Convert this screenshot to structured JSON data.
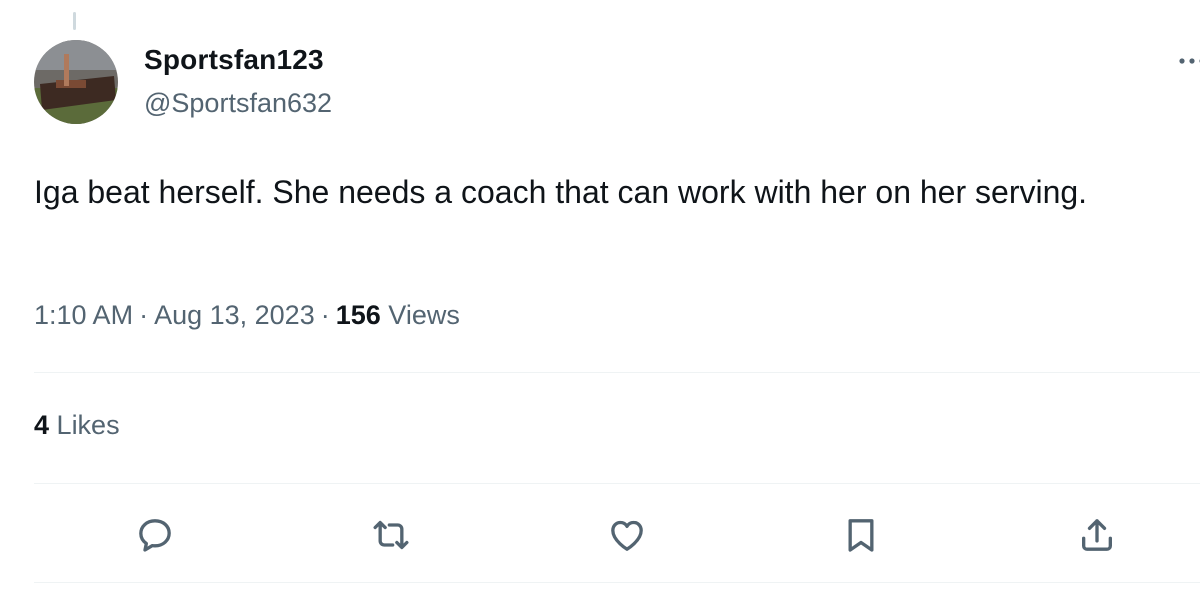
{
  "author": {
    "display_name": "Sportsfan123",
    "handle": "@Sportsfan632",
    "avatar_icon": "avatar-photo"
  },
  "tweet": {
    "text": "Iga beat herself. She needs a coach that can work with her on her serving."
  },
  "meta": {
    "time": "1:10 AM",
    "separator": "·",
    "date": "Aug 13, 2023",
    "views_count": "156",
    "views_label": "Views"
  },
  "stats": {
    "likes_count": "4",
    "likes_label": "Likes"
  },
  "actions": {
    "reply_icon": "reply-icon",
    "retweet_icon": "retweet-icon",
    "like_icon": "heart-icon",
    "bookmark_icon": "bookmark-icon",
    "share_icon": "share-icon"
  },
  "colors": {
    "text_primary": "#0f1419",
    "text_secondary": "#536471",
    "icon": "#536471",
    "divider": "#eff3f4"
  }
}
